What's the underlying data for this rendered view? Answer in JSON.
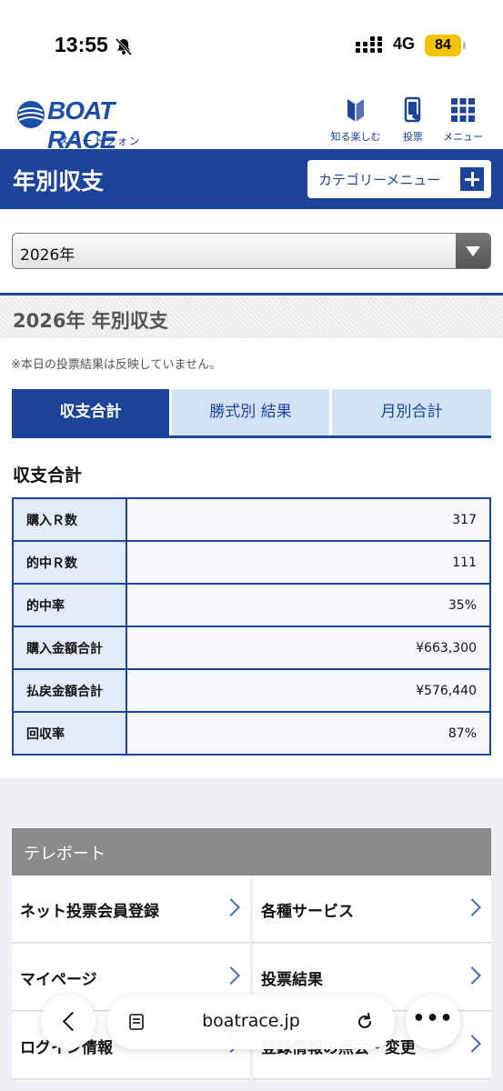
{
  "status": {
    "time": "13:55",
    "network": "4G",
    "battery": "84"
  },
  "header": {
    "logo_text": "BOAT RACE",
    "logo_sub": "スマートフォン",
    "nav": [
      {
        "label": "知る楽しむ",
        "icon": "beginner-mark-icon"
      },
      {
        "label": "投票",
        "icon": "smartphone-vote-icon"
      },
      {
        "label": "メニュー",
        "icon": "grid-menu-icon"
      }
    ]
  },
  "titlebar": {
    "title": "年別収支",
    "category_button": "カテゴリーメニュー"
  },
  "year_select": {
    "selected": "2026年"
  },
  "section": {
    "title": "2026年 年別収支",
    "note": "※本日の投票結果は反映していません。"
  },
  "tabs": [
    {
      "label": "収支合計",
      "active": true
    },
    {
      "label": "勝式別 結果",
      "active": false
    },
    {
      "label": "月別合計",
      "active": false
    }
  ],
  "summary": {
    "title": "収支合計",
    "rows": [
      {
        "label": "購入Ｒ数",
        "value": "317"
      },
      {
        "label": "的中Ｒ数",
        "value": "111"
      },
      {
        "label": "的中率",
        "value": "35%"
      },
      {
        "label": "購入金額合計",
        "value": "¥663,300"
      },
      {
        "label": "払戻金額合計",
        "value": "¥576,440"
      },
      {
        "label": "回収率",
        "value": "87%"
      }
    ]
  },
  "teleboat": {
    "title": "テレボート",
    "links": [
      "ネット投票会員登録",
      "各種サービス",
      "マイページ",
      "投票結果",
      "ログイン情報",
      "登録情報の照会・変更"
    ]
  },
  "browser": {
    "url": "boatrace.jp"
  },
  "colors": {
    "primary": "#1c449a",
    "tab_inactive": "#d3e3f6",
    "row_label": "#e1ebfa"
  }
}
